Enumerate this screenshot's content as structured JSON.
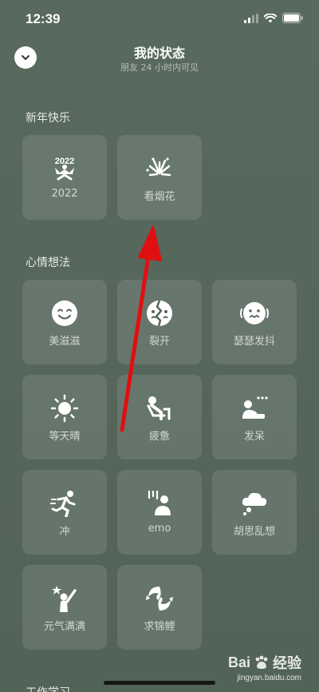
{
  "status_bar": {
    "time": "12:39"
  },
  "header": {
    "title": "我的状态",
    "subtitle": "朋友 24 小时内可见"
  },
  "sections": [
    {
      "title": "新年快乐",
      "items": [
        {
          "label": "2022",
          "icon": "new-year-2022-icon",
          "icon_text": "2022"
        },
        {
          "label": "看烟花",
          "icon": "fireworks-icon"
        }
      ]
    },
    {
      "title": "心情想法",
      "items": [
        {
          "label": "美滋滋",
          "icon": "smiley-icon"
        },
        {
          "label": "裂开",
          "icon": "cracked-face-icon"
        },
        {
          "label": "瑟瑟发抖",
          "icon": "shivering-face-icon"
        },
        {
          "label": "等天晴",
          "icon": "sun-icon"
        },
        {
          "label": "疲惫",
          "icon": "tired-person-icon"
        },
        {
          "label": "发呆",
          "icon": "daydream-icon"
        },
        {
          "label": "冲",
          "icon": "running-icon"
        },
        {
          "label": "emo",
          "icon": "emo-person-icon"
        },
        {
          "label": "胡思乱想",
          "icon": "thought-cloud-icon"
        },
        {
          "label": "元气满满",
          "icon": "energetic-icon"
        },
        {
          "label": "求锦鲤",
          "icon": "koi-icon"
        }
      ]
    },
    {
      "title": "工作学习"
    }
  ],
  "watermark": {
    "brand": "Bai",
    "brand_suffix": "经验",
    "url": "jingyan.baidu.com"
  },
  "colors": {
    "background": "#566759",
    "tile": "rgba(255,255,255,0.11)",
    "arrow": "#e01010"
  }
}
